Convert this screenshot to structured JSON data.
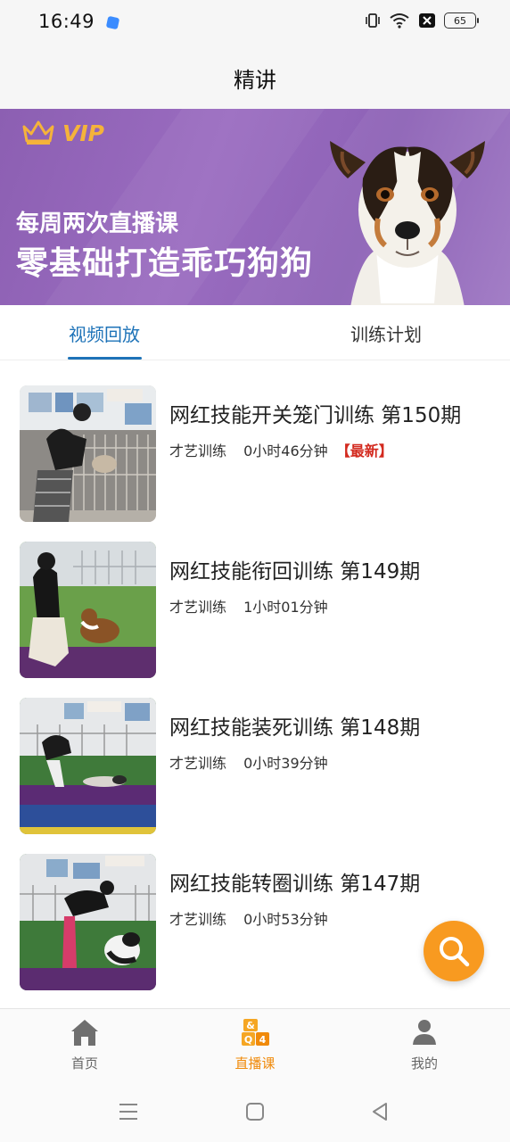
{
  "status_bar": {
    "time": "16:49",
    "battery": "65",
    "icons": [
      "vibrate-icon",
      "wifi-icon",
      "sim-blocked-icon",
      "battery-icon"
    ]
  },
  "header": {
    "title": "精讲"
  },
  "banner": {
    "vip_label": "VIP",
    "line1": "每周两次直播课",
    "line2": "零基础打造乖巧狗狗",
    "colors": {
      "background": "#9a6cc0",
      "vip": "#f5b33a"
    }
  },
  "tabs": [
    {
      "label": "视频回放",
      "active": true
    },
    {
      "label": "训练计划",
      "active": false
    }
  ],
  "videos": [
    {
      "title": "网红技能开关笼门训练 第150期",
      "category": "才艺训练",
      "duration": "0小时46分钟",
      "badge": "【最新】"
    },
    {
      "title": "网红技能衔回训练 第149期",
      "category": "才艺训练",
      "duration": "1小时01分钟",
      "badge": ""
    },
    {
      "title": "网红技能装死训练 第148期",
      "category": "才艺训练",
      "duration": "0小时39分钟",
      "badge": ""
    },
    {
      "title": "网红技能转圈训练 第147期",
      "category": "才艺训练",
      "duration": "0小时53分钟",
      "badge": ""
    }
  ],
  "bottom_nav": [
    {
      "label": "首页",
      "icon": "home-icon",
      "active": false
    },
    {
      "label": "直播课",
      "icon": "live-course-icon",
      "active": true
    },
    {
      "label": "我的",
      "icon": "user-icon",
      "active": false
    }
  ],
  "colors": {
    "accent": "#1e73b8",
    "fab": "#f89a20",
    "active_nav": "#f08a0a",
    "newest": "#d32a1f"
  }
}
